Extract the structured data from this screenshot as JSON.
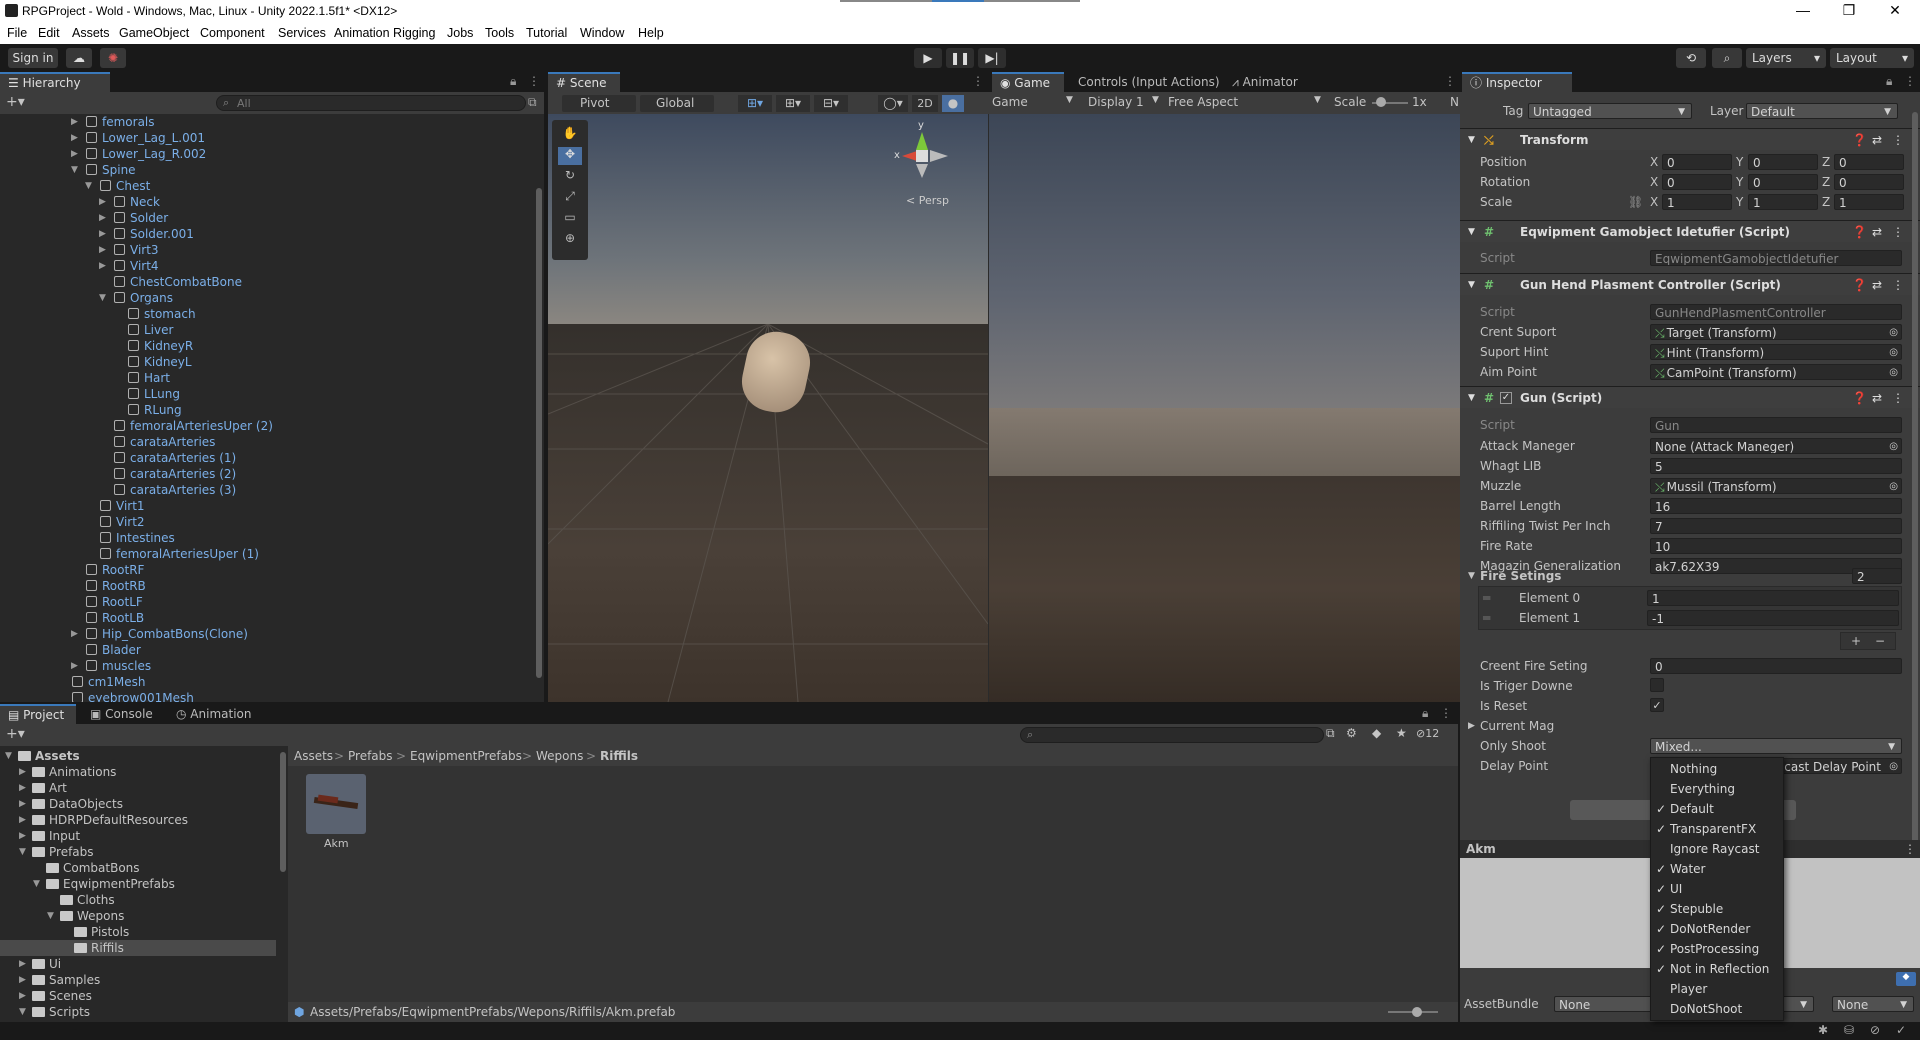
{
  "window": {
    "title": "RPGProject - Wold - Windows, Mac, Linux - Unity 2022.1.5f1* <DX12>",
    "controls": [
      "—",
      "❐",
      "✕"
    ]
  },
  "menu": [
    "File",
    "Edit",
    "Assets",
    "GameObject",
    "Component",
    "Services",
    "Animation Rigging",
    "Jobs",
    "Tools",
    "Tutorial",
    "Window",
    "Help"
  ],
  "toolbar": {
    "sign_in": "Sign in",
    "layers": "Layers",
    "layout": "Layout"
  },
  "hierarchy": {
    "tab": "Hierarchy",
    "search_placeholder": "All",
    "items": [
      {
        "label": "femorals",
        "depth": 4,
        "exp": "r",
        "blue": true
      },
      {
        "label": "Lower_Lag_L.001",
        "depth": 4,
        "exp": "r",
        "blue": true
      },
      {
        "label": "Lower_Lag_R.002",
        "depth": 4,
        "exp": "r",
        "blue": true
      },
      {
        "label": "Spine",
        "depth": 4,
        "exp": "d",
        "blue": true
      },
      {
        "label": "Chest",
        "depth": 5,
        "exp": "d",
        "blue": true
      },
      {
        "label": "Neck",
        "depth": 6,
        "exp": "r",
        "blue": true
      },
      {
        "label": "Solder",
        "depth": 6,
        "exp": "r",
        "blue": true
      },
      {
        "label": "Solder.001",
        "depth": 6,
        "exp": "r",
        "blue": true
      },
      {
        "label": "Virt3",
        "depth": 6,
        "exp": "r",
        "blue": true
      },
      {
        "label": "Virt4",
        "depth": 6,
        "exp": "r",
        "blue": true
      },
      {
        "label": "ChestCombatBone",
        "depth": 6,
        "exp": "",
        "blue": true
      },
      {
        "label": "Organs",
        "depth": 6,
        "exp": "d",
        "blue": true
      },
      {
        "label": "stomach",
        "depth": 7,
        "exp": "",
        "blue": true
      },
      {
        "label": "Liver",
        "depth": 7,
        "exp": "",
        "blue": true
      },
      {
        "label": "KidneyR",
        "depth": 7,
        "exp": "",
        "blue": true
      },
      {
        "label": "KidneyL",
        "depth": 7,
        "exp": "",
        "blue": true
      },
      {
        "label": "Hart",
        "depth": 7,
        "exp": "",
        "blue": true
      },
      {
        "label": "LLung",
        "depth": 7,
        "exp": "",
        "blue": true
      },
      {
        "label": "RLung",
        "depth": 7,
        "exp": "",
        "blue": true
      },
      {
        "label": "femoralArteriesUper (2)",
        "depth": 6,
        "exp": "",
        "blue": true
      },
      {
        "label": "carataArteries",
        "depth": 6,
        "exp": "",
        "blue": true
      },
      {
        "label": "carataArteries (1)",
        "depth": 6,
        "exp": "",
        "blue": true
      },
      {
        "label": "carataArteries (2)",
        "depth": 6,
        "exp": "",
        "blue": true
      },
      {
        "label": "carataArteries (3)",
        "depth": 6,
        "exp": "",
        "blue": true
      },
      {
        "label": "Virt1",
        "depth": 5,
        "exp": "",
        "blue": true
      },
      {
        "label": "Virt2",
        "depth": 5,
        "exp": "",
        "blue": true
      },
      {
        "label": "Intestines",
        "depth": 5,
        "exp": "",
        "blue": true
      },
      {
        "label": "femoralArteriesUper (1)",
        "depth": 5,
        "exp": "",
        "blue": true
      },
      {
        "label": "RootRF",
        "depth": 4,
        "exp": "",
        "blue": true
      },
      {
        "label": "RootRB",
        "depth": 4,
        "exp": "",
        "blue": true
      },
      {
        "label": "RootLF",
        "depth": 4,
        "exp": "",
        "blue": true
      },
      {
        "label": "RootLB",
        "depth": 4,
        "exp": "",
        "blue": true
      },
      {
        "label": "Hip_CombatBons(Clone)",
        "depth": 4,
        "exp": "r",
        "blue": true
      },
      {
        "label": "Blader",
        "depth": 4,
        "exp": "",
        "blue": true
      },
      {
        "label": "muscles",
        "depth": 4,
        "exp": "r",
        "blue": true
      },
      {
        "label": "cm1Mesh",
        "depth": 3,
        "exp": "",
        "blue": true
      },
      {
        "label": "eyebrow001Mesh",
        "depth": 3,
        "exp": "",
        "blue": true
      }
    ]
  },
  "scene": {
    "tab": "Scene",
    "pivot": "Pivot",
    "global": "Global",
    "two_d": "2D",
    "persp": "< Persp",
    "gizmo_y": "y",
    "gizmo_x": "x"
  },
  "game": {
    "tabs": [
      "Game",
      "Controls (Input Actions)",
      "Animator"
    ],
    "mode": "Game",
    "display": "Display 1",
    "aspect": "Free Aspect",
    "scale_label": "Scale",
    "scale_value": "1x",
    "n": "N"
  },
  "inspector": {
    "tab": "Inspector",
    "tag_label": "Tag",
    "tag_value": "Untagged",
    "layer_label": "Layer",
    "layer_value": "Default",
    "transform": {
      "title": "Transform",
      "rows": [
        {
          "label": "Position",
          "x": "0",
          "y": "0",
          "z": "0"
        },
        {
          "label": "Rotation",
          "x": "0",
          "y": "0",
          "z": "0"
        },
        {
          "label": "Scale",
          "x": "1",
          "y": "1",
          "z": "1"
        }
      ]
    },
    "comp1": {
      "title": "Eqwipment Gamobject Idetufier (Script)",
      "script_label": "Script",
      "script": "EqwipmentGamobjectIdetufier"
    },
    "comp2": {
      "title": "Gun Hend Plasment Controller (Script)",
      "script_label": "Script",
      "script": "GunHendPlasmentController",
      "rows": [
        {
          "label": "Crent Suport",
          "value": "Target (Transform)"
        },
        {
          "label": "Suport Hint",
          "value": "Hint (Transform)"
        },
        {
          "label": "Aim Point",
          "value": "CamPoint (Transform)"
        }
      ]
    },
    "gun": {
      "title": "Gun (Script)",
      "script_label": "Script",
      "script": "Gun",
      "rows": [
        {
          "label": "Attack Maneger",
          "value": "None (Attack Maneger)"
        },
        {
          "label": "Whagt LIB",
          "value": "5"
        },
        {
          "label": "Muzzle",
          "value": "Mussil (Transform)"
        },
        {
          "label": "Barrel Length",
          "value": "16"
        },
        {
          "label": "Riffiling Twist Per Inch",
          "value": "7"
        },
        {
          "label": "Fire Rate",
          "value": "10"
        },
        {
          "label": "Magazin Generalization",
          "value": "ak7.62X39"
        }
      ],
      "fire_setings_label": "Fire Setings",
      "fire_setings_count": "2",
      "elements": [
        {
          "label": "Element 0",
          "value": "1"
        },
        {
          "label": "Element 1",
          "value": "-1"
        }
      ],
      "crent_fire_label": "Creent Fire Seting",
      "crent_fire_value": "0",
      "is_triger_label": "Is Triger Downe",
      "is_reset_label": "Is Reset",
      "is_reset_check": "✓",
      "current_mag_label": "Current Mag",
      "only_shoot_label": "Only Shoot",
      "only_shoot_value": "Mixed...",
      "delay_point_label": "Delay Point",
      "delay_point_value": "ycast Delay Point"
    },
    "add_component": "A",
    "preview_title": "Akm",
    "assetbundle_label": "AssetBundle",
    "assetbundle_value": "None",
    "assetbundle_variant": "None"
  },
  "dropdown": {
    "items": [
      {
        "label": "Nothing",
        "checked": ""
      },
      {
        "label": "Everything",
        "checked": ""
      },
      {
        "label": "Default",
        "checked": "✓"
      },
      {
        "label": "TransparentFX",
        "checked": "✓"
      },
      {
        "label": "Ignore Raycast",
        "checked": ""
      },
      {
        "label": "Water",
        "checked": "✓"
      },
      {
        "label": "UI",
        "checked": "✓"
      },
      {
        "label": "Stepuble",
        "checked": "✓"
      },
      {
        "label": "DoNotRender",
        "checked": "✓"
      },
      {
        "label": "PostProcessing",
        "checked": "✓"
      },
      {
        "label": "Not in Reflection",
        "checked": "✓"
      },
      {
        "label": "Player",
        "checked": ""
      },
      {
        "label": "DoNotShoot",
        "checked": ""
      }
    ]
  },
  "project": {
    "tabs": [
      "Project",
      "Console",
      "Animation"
    ],
    "hidden_count": "12",
    "tree": [
      {
        "label": "Assets",
        "depth": 0,
        "exp": "d",
        "bold": true
      },
      {
        "label": "Animations",
        "depth": 1,
        "exp": "r"
      },
      {
        "label": "Art",
        "depth": 1,
        "exp": "r"
      },
      {
        "label": "DataObjects",
        "depth": 1,
        "exp": "r"
      },
      {
        "label": "HDRPDefaultResources",
        "depth": 1,
        "exp": "r"
      },
      {
        "label": "Input",
        "depth": 1,
        "exp": "r"
      },
      {
        "label": "Prefabs",
        "depth": 1,
        "exp": "d"
      },
      {
        "label": "CombatBons",
        "depth": 2,
        "exp": ""
      },
      {
        "label": "EqwipmentPrefabs",
        "depth": 2,
        "exp": "d"
      },
      {
        "label": "Cloths",
        "depth": 3,
        "exp": ""
      },
      {
        "label": "Wepons",
        "depth": 3,
        "exp": "d"
      },
      {
        "label": "Pistols",
        "depth": 4,
        "exp": ""
      },
      {
        "label": "Riffils",
        "depth": 4,
        "exp": "",
        "selected": true
      },
      {
        "label": "Ui",
        "depth": 1,
        "exp": "r"
      },
      {
        "label": "Samples",
        "depth": 1,
        "exp": "r"
      },
      {
        "label": "Scenes",
        "depth": 1,
        "exp": "r"
      },
      {
        "label": "Scripts",
        "depth": 1,
        "exp": "d"
      }
    ],
    "breadcrumb": [
      "Assets",
      "Prefabs",
      "EqwipmentPrefabs",
      "Wepons",
      "Riffils"
    ],
    "asset_name": "Akm",
    "status_path": "Assets/Prefabs/EqwipmentPrefabs/Wepons/Riffils/Akm.prefab"
  },
  "colors": {
    "accent": "#3a79bb",
    "blue_text": "#7bafe8",
    "panel": "#282828"
  }
}
